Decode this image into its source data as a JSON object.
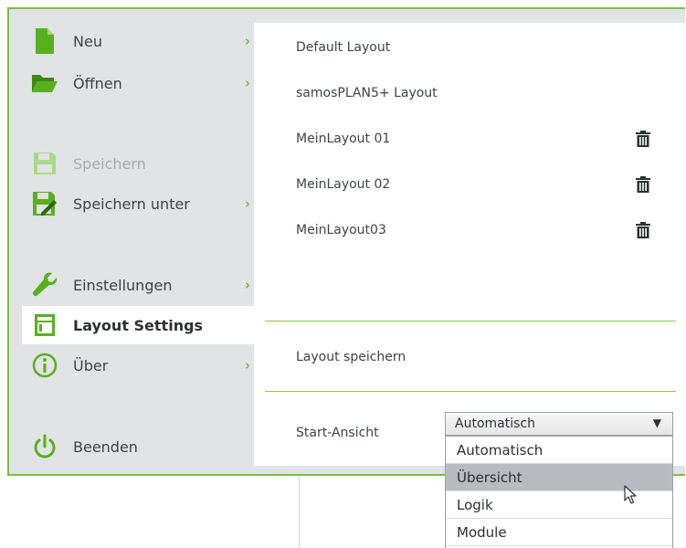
{
  "sidebar": {
    "items": [
      {
        "label": "Neu",
        "icon": "new-file-icon",
        "submenu": true,
        "disabled": false,
        "active": false
      },
      {
        "label": "Öffnen",
        "icon": "open-folder-icon",
        "submenu": true,
        "disabled": false,
        "active": false
      },
      {
        "label": "Speichern",
        "icon": "save-disk-icon",
        "submenu": false,
        "disabled": true,
        "active": false
      },
      {
        "label": "Speichern unter",
        "icon": "save-as-icon",
        "submenu": true,
        "disabled": false,
        "active": false
      },
      {
        "label": "Einstellungen",
        "icon": "wrench-icon",
        "submenu": true,
        "disabled": false,
        "active": false
      },
      {
        "label": "Layout Settings",
        "icon": "layout-icon",
        "submenu": false,
        "disabled": false,
        "active": true
      },
      {
        "label": "Über",
        "icon": "info-icon",
        "submenu": true,
        "disabled": false,
        "active": false
      },
      {
        "label": "Beenden",
        "icon": "power-icon",
        "submenu": false,
        "disabled": false,
        "active": false
      }
    ],
    "chevron": "›"
  },
  "layouts": [
    {
      "name": "Default Layout",
      "deletable": false
    },
    {
      "name": "samosPLAN5+ Layout",
      "deletable": false
    },
    {
      "name": "MeinLayout 01",
      "deletable": true
    },
    {
      "name": "MeinLayout 02",
      "deletable": true
    },
    {
      "name": "MeinLayout03",
      "deletable": true
    }
  ],
  "save_layout_label": "Layout speichern",
  "start_view": {
    "label": "Start-Ansicht",
    "selected": "Automatisch",
    "options": [
      "Automatisch",
      "Übersicht",
      "Logik",
      "Module"
    ],
    "hovered": "Übersicht"
  },
  "colors": {
    "accent_green": "#78c040",
    "icon_green": "#58b020",
    "sidebar_bg": "#e1e3e4",
    "disabled": "#a8acaf"
  }
}
